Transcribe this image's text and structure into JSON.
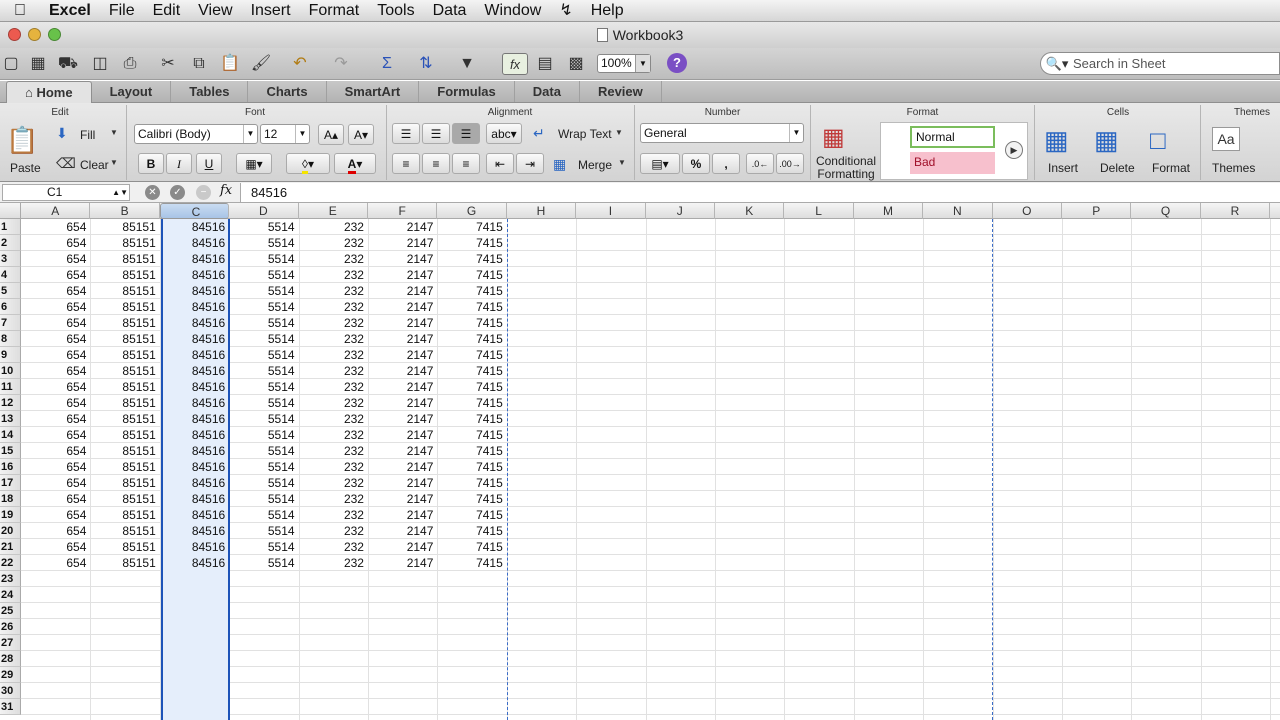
{
  "menubar": {
    "apple": "",
    "items": [
      "Excel",
      "File",
      "Edit",
      "View",
      "Insert",
      "Format",
      "Tools",
      "Data",
      "Window",
      "",
      "Help"
    ]
  },
  "window": {
    "title": "Workbook3"
  },
  "toolbar": {
    "zoom": "100%",
    "search_placeholder": "Search in Sheet"
  },
  "ribbon_tabs": [
    "Home",
    "Layout",
    "Tables",
    "Charts",
    "SmartArt",
    "Formulas",
    "Data",
    "Review"
  ],
  "ribbon": {
    "groups": {
      "edit": "Edit",
      "font": "Font",
      "alignment": "Alignment",
      "number": "Number",
      "format": "Format",
      "cells": "Cells",
      "themes": "Themes"
    },
    "paste": "Paste",
    "fill": "Fill",
    "clear": "Clear",
    "font_name": "Calibri (Body)",
    "font_size": "12",
    "wrap_text": "Wrap Text",
    "merge": "Merge",
    "abc": "abc",
    "number_format": "General",
    "conditional_formatting": "Conditional Formatting",
    "style_normal": "Normal",
    "style_bad": "Bad",
    "insert": "Insert",
    "delete": "Delete",
    "format": "Format",
    "themes": "Themes"
  },
  "formula_bar": {
    "name_box": "C1",
    "fx": "fx",
    "value": "84516"
  },
  "sheet": {
    "columns": [
      "A",
      "B",
      "C",
      "D",
      "E",
      "F",
      "G",
      "H",
      "I",
      "J",
      "K",
      "L",
      "M",
      "N",
      "O",
      "P",
      "Q",
      "R"
    ],
    "selected_column": "C",
    "row_numbers": [
      "1",
      "2",
      "3",
      "4",
      "5",
      "6",
      "7",
      "8",
      "9",
      "10",
      "11",
      "12",
      "13",
      "14",
      "15",
      "16",
      "17",
      "18",
      "19",
      "20",
      "21",
      "22",
      "23",
      "24",
      "25",
      "26",
      "27",
      "28",
      "29",
      "30",
      "31"
    ],
    "row_values": [
      "654",
      "85151",
      "84516",
      "5514",
      "232",
      "2147",
      "7415"
    ],
    "filled_rows": 22
  },
  "colors": {
    "selection_border": "#1d53b8",
    "selection_fill": "#e5eefb",
    "bad_fill": "#f7c0cd",
    "normal_border": "#7bbd5c"
  }
}
